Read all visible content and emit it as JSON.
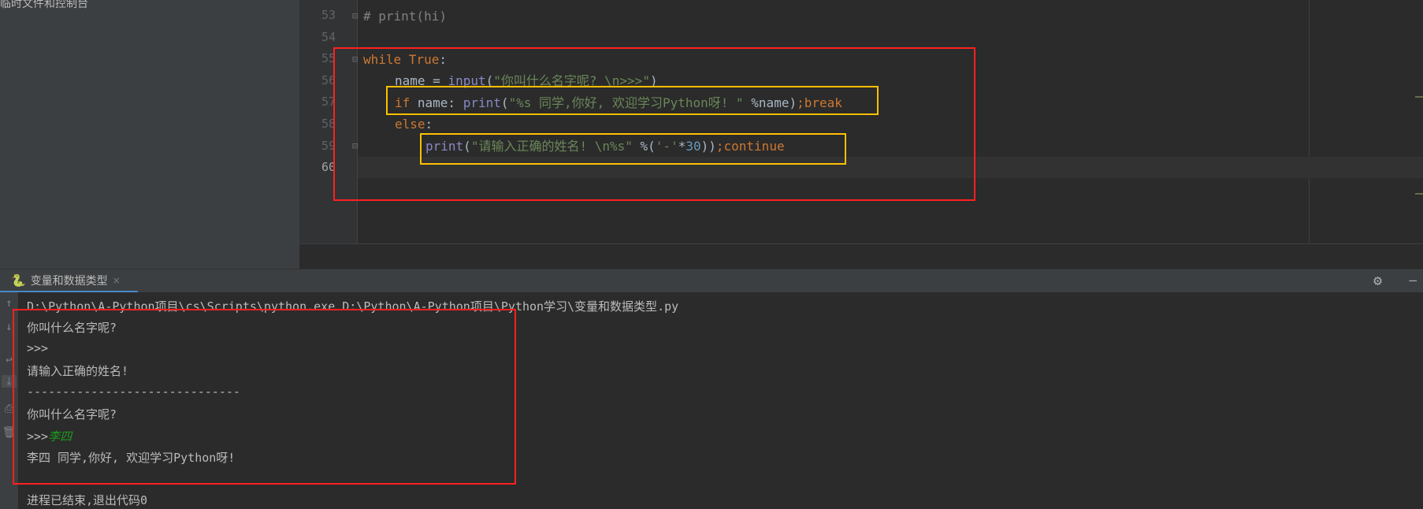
{
  "sidebar": {
    "label": "临时文件和控制台"
  },
  "editor": {
    "line_numbers": [
      "53",
      "54",
      "55",
      "56",
      "57",
      "58",
      "59",
      "60"
    ],
    "lines": {
      "l53": "# print(hi)",
      "l55_kw": "while True",
      "l55_colon": ":",
      "l56_a": "name = ",
      "l56_fn": "input",
      "l56_p": "(",
      "l56_s": "\"你叫什么名字呢? \\n>>>\"",
      "l56_e": ")",
      "l57_if": "if",
      "l57_a": " name: ",
      "l57_fn": "print",
      "l57_p": "(",
      "l57_s": "\"%s 同学,你好, 欢迎学习Python呀! \"",
      "l57_b": " %name)",
      "l57_semi": ";",
      "l57_brk": "break",
      "l58_else": "else",
      "l58_colon": ":",
      "l59_fn": "print",
      "l59_p": "(",
      "l59_s": "\"请输入正确的姓名! \\n%s\"",
      "l59_b": " %(",
      "l59_s2": "'-'",
      "l59_c": "*",
      "l59_n": "30",
      "l59_e": "))",
      "l59_semi": ";",
      "l59_cont": "continue"
    }
  },
  "run": {
    "tab_label": "变量和数据类型",
    "tab_close": "×",
    "console": [
      "D:\\Python\\A-Python项目\\cs\\Scripts\\python.exe D:\\Python\\A-Python项目\\Python学习\\变量和数据类型.py",
      "你叫什么名字呢?",
      ">>>",
      "请输入正确的姓名!",
      "------------------------------",
      "你叫什么名字呢?",
      ">>>",
      "李四 同学,你好, 欢迎学习Python呀!",
      "进程已结束,退出代码0"
    ],
    "user_input": "李四"
  },
  "colors": {
    "annotation_red": "#ff2020",
    "annotation_yellow": "#ffc000",
    "accent": "#4a88c7"
  }
}
